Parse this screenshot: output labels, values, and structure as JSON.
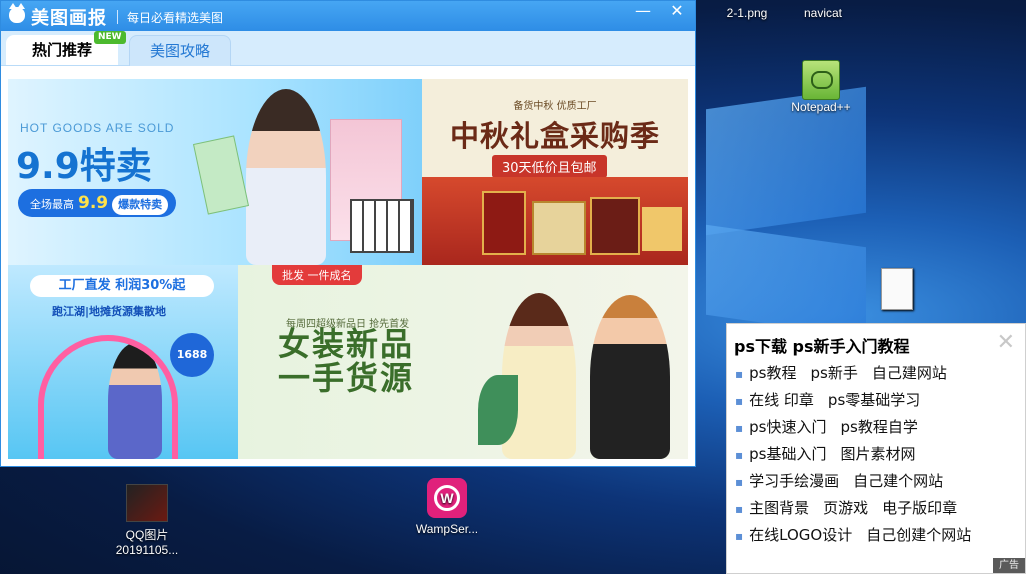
{
  "window": {
    "app_title": "美图画报",
    "subtitle": "每日必看精选美图",
    "min_label": "—",
    "close_label": "✕"
  },
  "tabs": [
    {
      "label": "热门推荐",
      "badge": "NEW"
    },
    {
      "label": "美图攻略"
    }
  ],
  "banners": {
    "b1": {
      "eng": "HOT GOODS ARE SOLD",
      "big": "9.9特卖",
      "pill_left": "全场最高",
      "pill_num": "9.9",
      "pill_right": "爆款特卖"
    },
    "b2": {
      "top": "备货中秋  优质工厂",
      "title": "中秋礼盒采购季",
      "sub": "30天低价且包邮"
    },
    "b3": {
      "sign": "工厂直发 利润30%起",
      "sign2": "跑江湖|地摊货源集散地",
      "num": "1688"
    },
    "b4": {
      "tag": "批发 一件成名",
      "small": "每周四超级新品日  抢先首发",
      "h1a": "女装新品",
      "h1b": "一手货源"
    }
  },
  "desktop_icons": [
    {
      "label": "2-1.png"
    },
    {
      "label": "navicat"
    },
    {
      "label": "Notepad++"
    },
    {
      "label": "QQ图片"
    },
    {
      "label": "20191105..."
    },
    {
      "label": "WampSer..."
    }
  ],
  "ad_panel": {
    "title": "ps下载   ps新手入门教程",
    "close": "✕",
    "rows": [
      [
        "ps教程",
        "ps新手",
        "自己建网站"
      ],
      [
        "在线 印章",
        "ps零基础学习"
      ],
      [
        "ps快速入门",
        "ps教程自学"
      ],
      [
        "ps基础入门",
        "图片素材网"
      ],
      [
        "学习手绘漫画",
        "自己建个网站"
      ],
      [
        "主图背景",
        "页游戏",
        "电子版印章"
      ],
      [
        "在线LOGO设计",
        "自己创建个网站"
      ]
    ],
    "ad_label": "广告"
  }
}
